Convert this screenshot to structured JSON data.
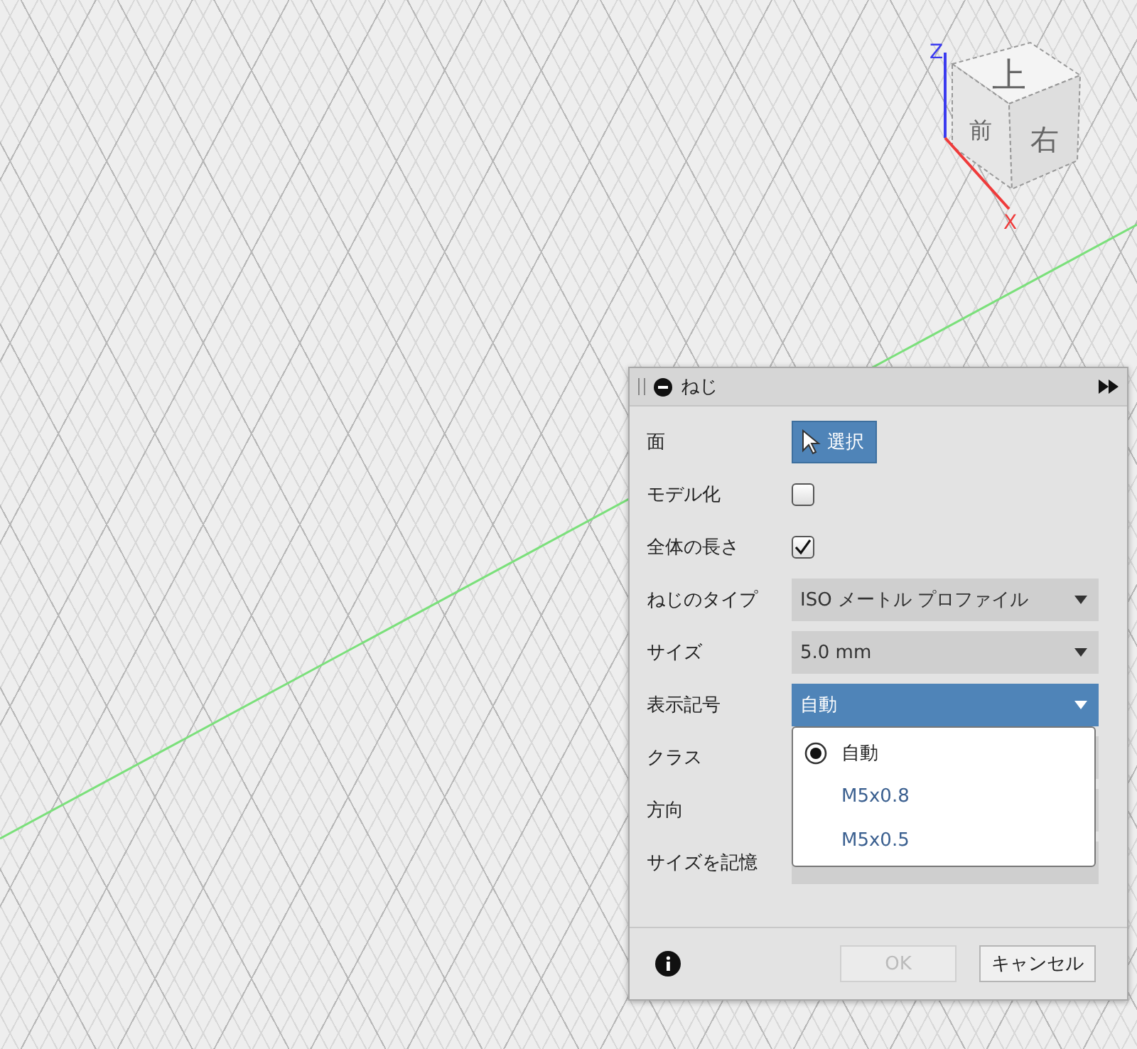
{
  "viewport": {
    "view_cube": {
      "top": "上",
      "front": "前",
      "right": "右",
      "z_axis": "Z",
      "x_axis": "X"
    }
  },
  "dialog": {
    "title": "ねじ",
    "rows": [
      {
        "label": "面",
        "kind": "select",
        "value": "選択"
      },
      {
        "label": "モデル化",
        "kind": "checkbox",
        "checked": false
      },
      {
        "label": "全体の長さ",
        "kind": "checkbox",
        "checked": true
      },
      {
        "label": "ねじのタイプ",
        "kind": "dropdown",
        "value": "ISO メートル プロファイル",
        "open": false
      },
      {
        "label": "サイズ",
        "kind": "dropdown",
        "value": "5.0 mm",
        "open": false
      },
      {
        "label": "表示記号",
        "kind": "dropdown",
        "value": "自動",
        "open": true
      },
      {
        "label": "クラス",
        "kind": "covered"
      },
      {
        "label": "方向",
        "kind": "covered"
      },
      {
        "label": "サイズを記憶",
        "kind": "covered"
      }
    ],
    "menu_options": [
      {
        "label": "自動",
        "selected": true
      },
      {
        "label": "M5x0.8",
        "selected": false
      },
      {
        "label": "M5x0.5",
        "selected": false
      }
    ],
    "buttons": [
      {
        "label": "OK",
        "disabled": true
      },
      {
        "label": "キャンセル",
        "disabled": false
      }
    ]
  }
}
